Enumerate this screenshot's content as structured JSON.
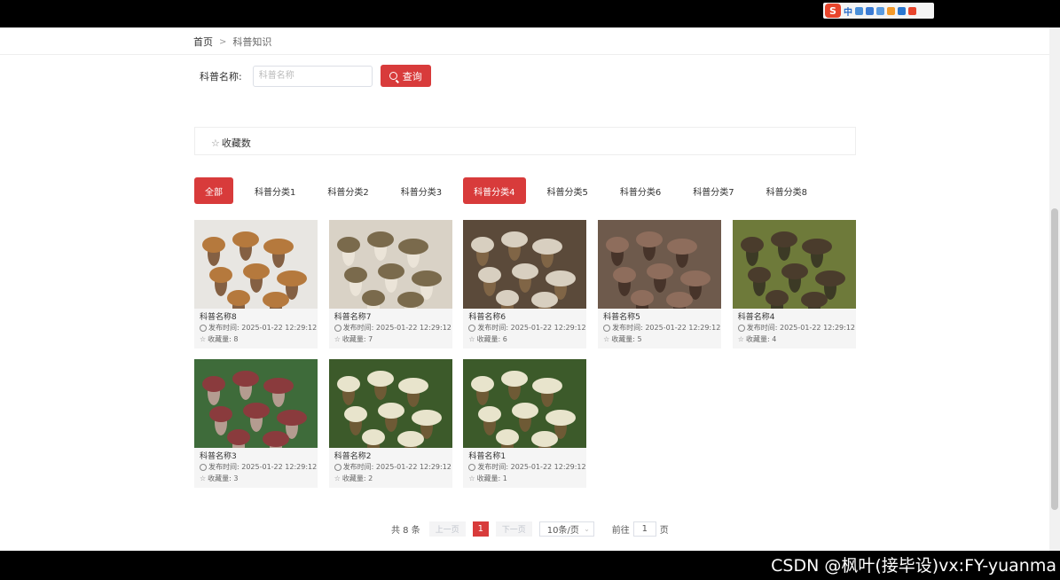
{
  "breadcrumb": {
    "home": "首页",
    "sep": ">",
    "current": "科普知识"
  },
  "search": {
    "label": "科普名称:",
    "placeholder": "科普名称",
    "button": "查询"
  },
  "sort": {
    "label": "收藏数"
  },
  "tabs": [
    "全部",
    "科普分类1",
    "科普分类2",
    "科普分类3",
    "科普分类4",
    "科普分类5",
    "科普分类6",
    "科普分类7",
    "科普分类8"
  ],
  "active_tabs": [
    "全部",
    "科普分类4"
  ],
  "cards": [
    {
      "name": "科普名称8",
      "time_label": "发布时间: 2025-01-22 12:29:12",
      "fav_label": "收藏量: 8",
      "image": "porcini-mushrooms"
    },
    {
      "name": "科普名称7",
      "time_label": "发布时间: 2025-01-22 12:29:12",
      "fav_label": "收藏量: 7",
      "image": "matsutake-mushrooms"
    },
    {
      "name": "科普名称6",
      "time_label": "发布时间: 2025-01-22 12:29:12",
      "fav_label": "收藏量: 6",
      "image": "mixed-wild-mushrooms"
    },
    {
      "name": "科普名称5",
      "time_label": "发布时间: 2025-01-22 12:29:12",
      "fav_label": "收藏量: 5",
      "image": "shiitake-mushrooms"
    },
    {
      "name": "科普名称4",
      "time_label": "发布时间: 2025-01-22 12:29:12",
      "fav_label": "收藏量: 4",
      "image": "morel-mushrooms"
    },
    {
      "name": "科普名称3",
      "time_label": "发布时间: 2025-01-22 12:29:12",
      "fav_label": "收藏量: 3",
      "image": "red-mushrooms"
    },
    {
      "name": "科普名称2",
      "time_label": "发布时间: 2025-01-22 12:29:12",
      "fav_label": "收藏量: 2",
      "image": "enoki-cluster"
    },
    {
      "name": "科普名称1",
      "time_label": "发布时间: 2025-01-22 12:29:12",
      "fav_label": "收藏量: 1",
      "image": "enoki-cluster"
    }
  ],
  "pagination": {
    "total": "共 8 条",
    "prev": "上一页",
    "next": "下一页",
    "current_page": "1",
    "page_size": "10条/页",
    "goto": "前往",
    "goto_value": "1",
    "page_suffix": "页"
  },
  "ime": {
    "mode": "中"
  },
  "watermark": "CSDN @枫叶(接毕设)vx:FY-yuanma",
  "colors": {
    "accent": "#d83b3b"
  }
}
